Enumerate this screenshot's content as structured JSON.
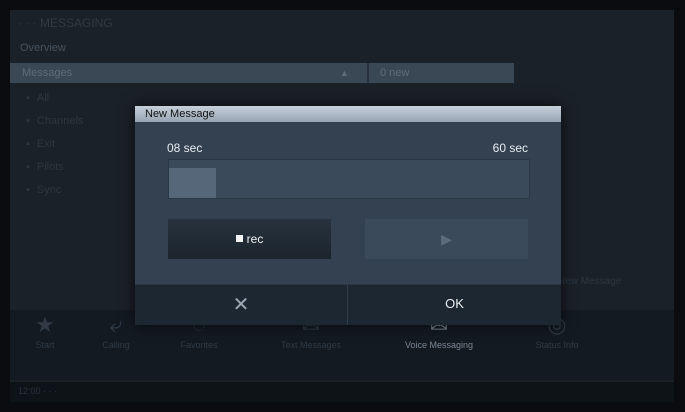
{
  "background": {
    "title": "· · · MESSAGING",
    "subtitle": "Overview",
    "bar_label": "Messages",
    "bar_count": "0 new",
    "filters": [
      "All",
      "Channels",
      "Exit",
      "Pilots",
      "Sync"
    ],
    "right_label": "New Message",
    "nav": [
      {
        "icon": "★",
        "label": "Start"
      },
      {
        "icon": "⤶",
        "label": "Calling"
      },
      {
        "icon": "◌",
        "label": "Favorites"
      },
      {
        "icon": "✉",
        "label": "Text Messages"
      },
      {
        "icon": "✉",
        "label": "Voice Messaging"
      },
      {
        "icon": "◎",
        "label": "Status Info"
      }
    ],
    "status_text": "12:00  · · ·"
  },
  "dialog": {
    "title": "New Message",
    "elapsed": "08 sec",
    "max": "60 sec",
    "progress": 0.13,
    "rec_label": "rec",
    "play_icon": "▶",
    "cancel_icon": "✕",
    "ok_label": "OK"
  }
}
